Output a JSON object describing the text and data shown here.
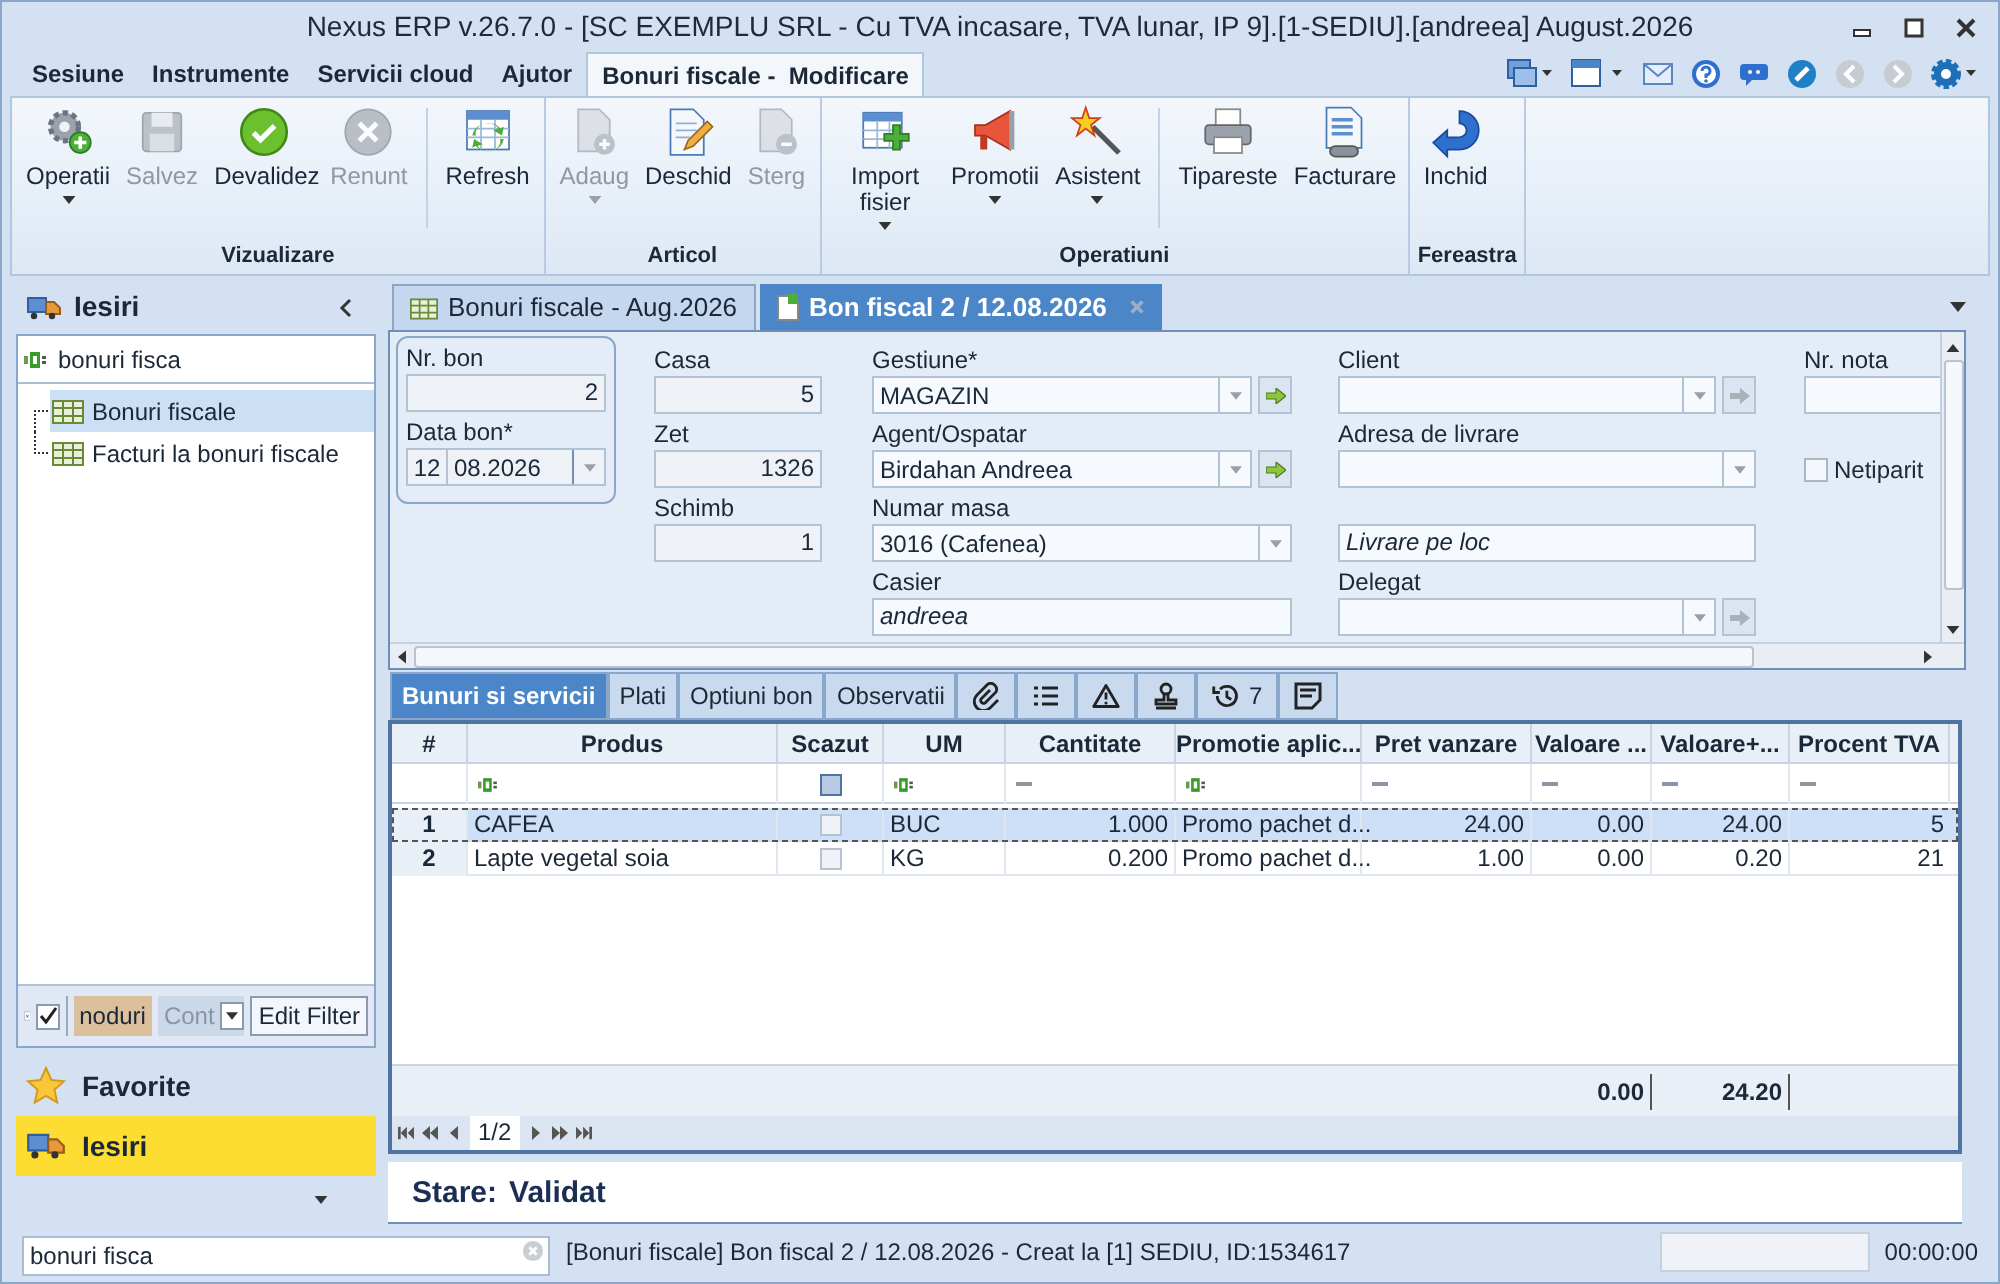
{
  "window": {
    "title": "Nexus ERP v.26.7.0 - [SC EXEMPLU SRL - Cu TVA incasare, TVA lunar, IP 9].[1-SEDIU].[andreea] August.2026"
  },
  "menu_tabs": [
    {
      "label": "Sesiune",
      "selected": false
    },
    {
      "label": "Instrumente",
      "selected": false
    },
    {
      "label": "Servicii cloud",
      "selected": false
    },
    {
      "label": "Ajutor",
      "selected": false
    },
    {
      "label": "Bonuri fiscale -  Modificare",
      "selected": true
    }
  ],
  "ribbon": {
    "groups": [
      {
        "label": "Vizualizare",
        "buttons": [
          {
            "label": "Operatii",
            "disabled": false,
            "dropdown": true
          },
          {
            "label": "Salvez",
            "disabled": true,
            "dropdown": false
          },
          {
            "label": "Devalidez",
            "disabled": false,
            "dropdown": false
          },
          {
            "label": "Renunt",
            "disabled": true,
            "dropdown": false
          },
          {
            "label": "Refresh",
            "disabled": false,
            "dropdown": false,
            "separator_before": true
          }
        ]
      },
      {
        "label": "Articol",
        "buttons": [
          {
            "label": "Adaug",
            "disabled": true,
            "dropdown": true
          },
          {
            "label": "Deschid",
            "disabled": false,
            "dropdown": false
          },
          {
            "label": "Sterg",
            "disabled": true,
            "dropdown": false
          }
        ]
      },
      {
        "label": "Operatiuni",
        "buttons": [
          {
            "label": "Import fisier",
            "disabled": false,
            "dropdown": true
          },
          {
            "label": "Promotii",
            "disabled": false,
            "dropdown": true
          },
          {
            "label": "Asistent",
            "disabled": false,
            "dropdown": true
          },
          {
            "label": "Tipareste",
            "disabled": false,
            "dropdown": false,
            "separator_before": true
          },
          {
            "label": "Facturare",
            "disabled": false,
            "dropdown": false
          }
        ]
      },
      {
        "label": "Fereastra",
        "buttons": [
          {
            "label": "Inchid",
            "disabled": false,
            "dropdown": false
          }
        ]
      }
    ]
  },
  "sidebar": {
    "header": "Iesiri",
    "search": {
      "value": "bonuri fisca"
    },
    "tree": [
      {
        "label": "Bonuri fiscale",
        "selected": true
      },
      {
        "label": "Facturi la bonuri fiscale",
        "selected": false
      }
    ],
    "filter_bar": {
      "checked": true,
      "tag": "noduri",
      "combo": "Cont",
      "button": "Edit Filter"
    },
    "nav": [
      {
        "label": "Favorite",
        "selected": false
      },
      {
        "label": "Iesiri",
        "selected": true
      }
    ]
  },
  "doc_tabs": [
    {
      "label": "Bonuri fiscale - Aug.2026",
      "selected": false,
      "closable": false
    },
    {
      "label": "Bon fiscal 2 / 12.08.2026",
      "selected": true,
      "closable": true
    }
  ],
  "form": {
    "columns": [
      {
        "grouped": true,
        "fields": [
          {
            "kind": "number",
            "label": "Nr. bon",
            "value": "2"
          },
          {
            "kind": "date",
            "label": "Data bon*",
            "day": "12",
            "value": "08.2026"
          }
        ]
      },
      {
        "fields": [
          {
            "kind": "number",
            "label": "Casa",
            "value": "5"
          },
          {
            "kind": "number",
            "label": "Zet",
            "value": "1326"
          },
          {
            "kind": "number",
            "label": "Schimb",
            "value": "1"
          }
        ]
      },
      {
        "fields": [
          {
            "kind": "combo",
            "label": "Gestiune*",
            "value": "MAGAZIN",
            "go": {
              "disabled": false
            }
          },
          {
            "kind": "combo",
            "label": "Agent/Ospatar",
            "value": "Birdahan Andreea",
            "go": {
              "disabled": false
            }
          },
          {
            "kind": "combo",
            "label": "Numar masa",
            "value": "3016 (Cafenea)"
          },
          {
            "kind": "text",
            "label": "Casier",
            "value": "andreea",
            "italic": true
          }
        ]
      },
      {
        "fields": [
          {
            "kind": "combo",
            "label": "Client",
            "go": {
              "disabled": true
            }
          },
          {
            "kind": "combo",
            "label": "Adresa de livrare"
          },
          {
            "kind": "text",
            "value": "Livrare pe loc",
            "italic": true
          },
          {
            "kind": "combo",
            "label": "Delegat",
            "go": {
              "disabled": true
            }
          }
        ]
      },
      {
        "fields": [
          {
            "kind": "text",
            "label": "Nr. nota"
          },
          {
            "kind": "checkbox",
            "label": "Netiparit",
            "checked": false
          }
        ]
      }
    ]
  },
  "sub_tabs": [
    {
      "label": "Bunuri si servicii",
      "selected": true
    },
    {
      "label": "Plati",
      "selected": false
    },
    {
      "label": "Optiuni bon",
      "selected": false
    },
    {
      "label": "Observatii",
      "selected": false
    }
  ],
  "icon_tabs": [
    {
      "selected": false
    },
    {
      "selected": false
    },
    {
      "selected": false
    },
    {
      "selected": false
    },
    {
      "selected": false,
      "count": "7"
    },
    {
      "selected": false
    }
  ],
  "table": {
    "columns": [
      {
        "label": "#"
      },
      {
        "label": "Produs"
      },
      {
        "label": "Scazut"
      },
      {
        "label": "UM"
      },
      {
        "label": "Cantitate"
      },
      {
        "label": "Promotie aplic..."
      },
      {
        "label": "Pret vanzare"
      },
      {
        "label": "Valoare ...",
        "total": "0.00"
      },
      {
        "label": "Valoare+...",
        "total": "24.20"
      },
      {
        "label": "Procent TVA"
      }
    ],
    "filters": [
      {
        "kind": "none"
      },
      {
        "kind": "text"
      },
      {
        "kind": "checkbox",
        "indeterminate": true
      },
      {
        "kind": "text"
      },
      {
        "kind": "number"
      },
      {
        "kind": "text"
      },
      {
        "kind": "number"
      },
      {
        "kind": "number"
      },
      {
        "kind": "number"
      },
      {
        "kind": "number"
      }
    ],
    "rows": [
      {
        "selected": true,
        "cells": [
          "1",
          "CAFEA",
          false,
          "BUC",
          "1.000",
          "Promo pachet d...",
          "24.00",
          "0.00",
          "24.00",
          "5"
        ]
      },
      {
        "selected": false,
        "cells": [
          "2",
          "Lapte vegetal soia",
          false,
          "KG",
          "0.200",
          "Promo pachet d...",
          "1.00",
          "0.00",
          "0.20",
          "21"
        ]
      }
    ],
    "pager": "1/2"
  },
  "state": {
    "label": "Stare:",
    "value": "Validat"
  },
  "status_bar": {
    "search": "bonuri fisca",
    "message": "[Bonuri fiscale] Bon fiscal 2 / 12.08.2026 - Creat la [1] SEDIU, ID:1534617",
    "time": "00:00:00"
  }
}
